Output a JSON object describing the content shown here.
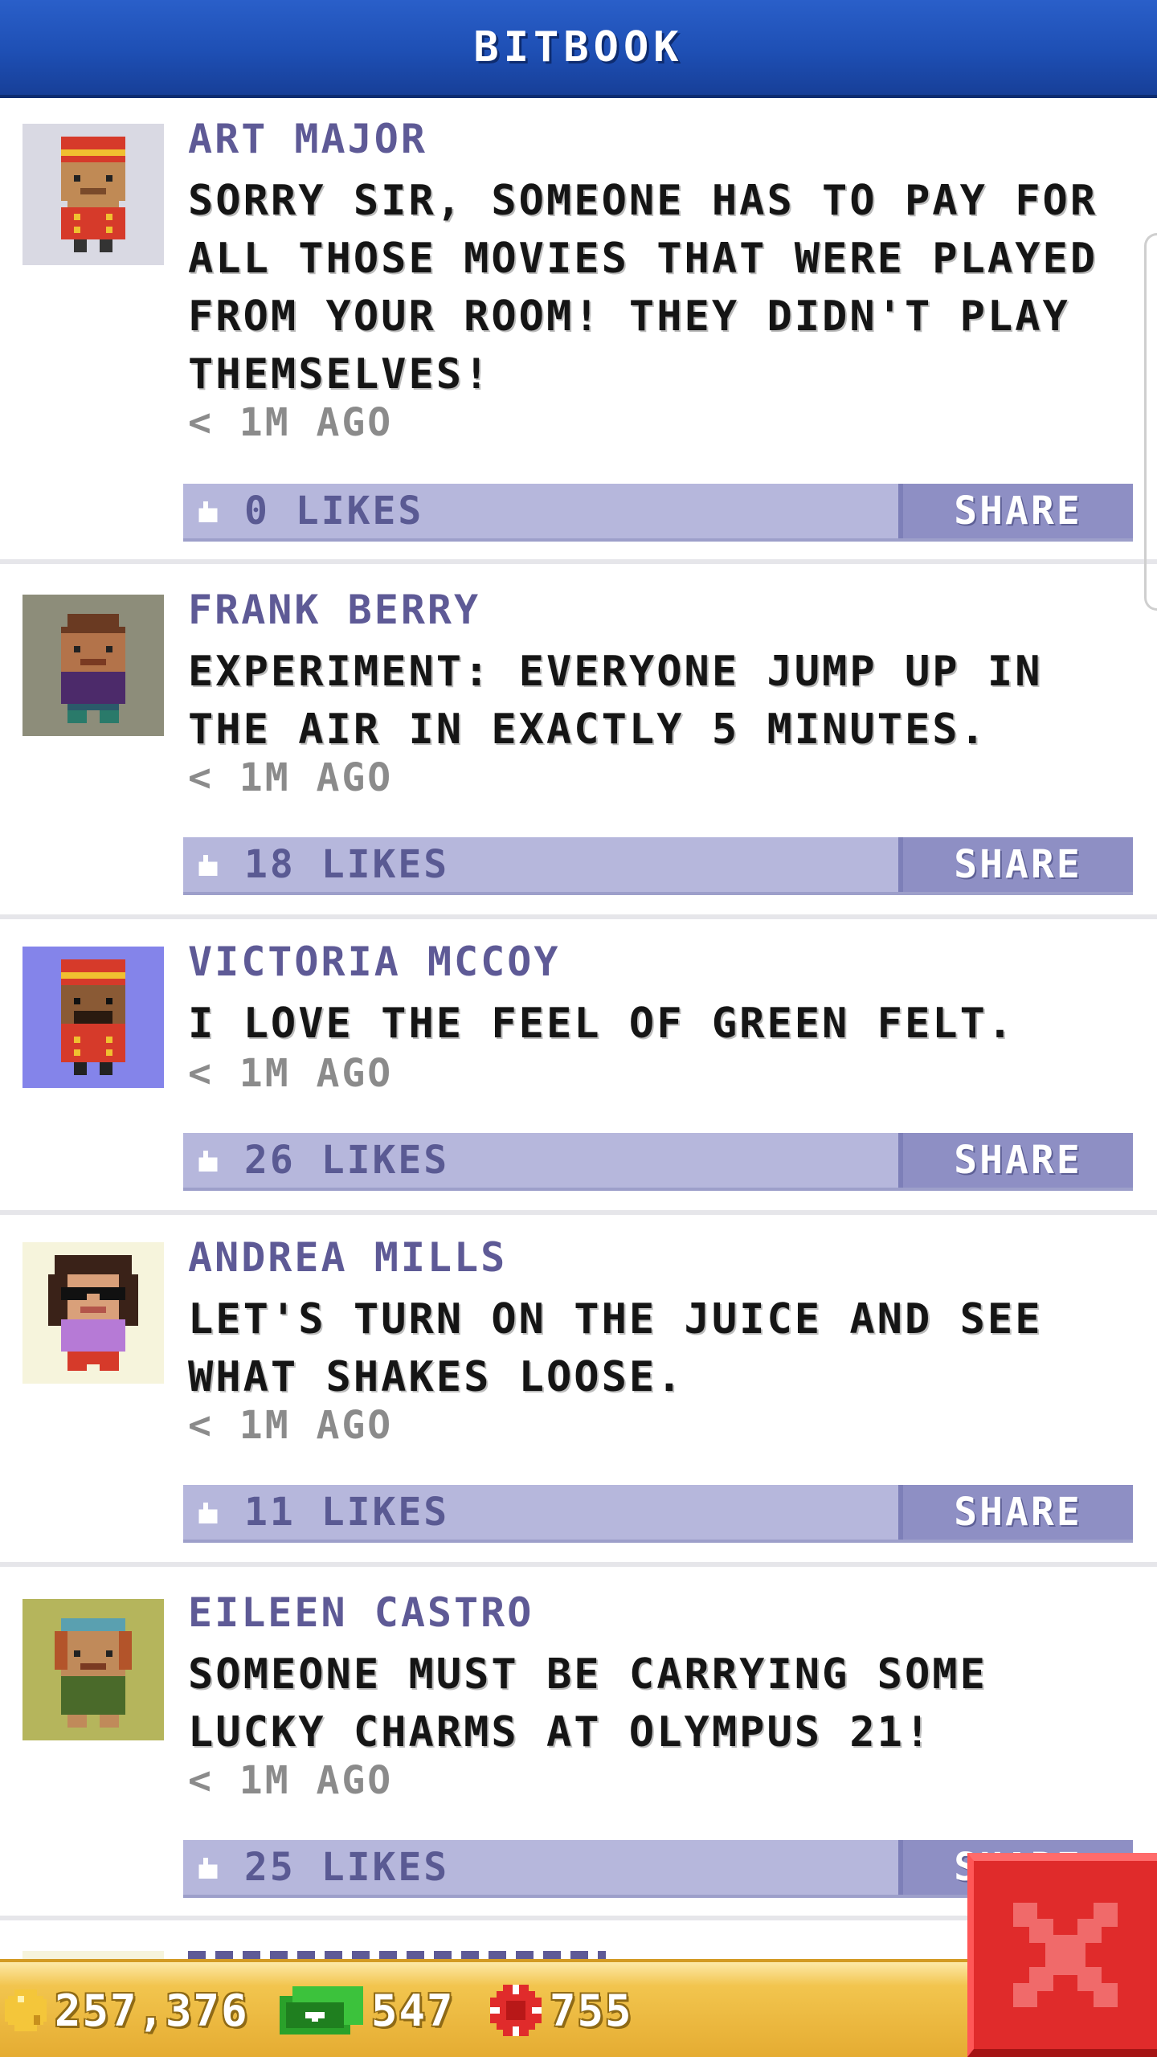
{
  "header": {
    "title": "BITBOOK"
  },
  "posts": [
    {
      "author": "ART MAJOR",
      "text": "SORRY SIR, SOMEONE HAS TO PAY FOR ALL THOSE MOVIES THAT WERE PLAYED FROM YOUR ROOM! THEY DIDN'T PLAY THEMSELVES!",
      "time": "< 1M AGO",
      "likes": "0 LIKES",
      "share": "SHARE",
      "avatar_bg": "#d9d9e3"
    },
    {
      "author": "FRANK BERRY",
      "text": "EXPERIMENT: EVERYONE JUMP UP IN THE AIR IN EXACTLY 5 MINUTES.",
      "time": "< 1M AGO",
      "likes": "18 LIKES",
      "share": "SHARE",
      "avatar_bg": "#8d8d7a"
    },
    {
      "author": "VICTORIA MCCOY",
      "text": "I LOVE THE FEEL OF GREEN FELT.",
      "time": "< 1M AGO",
      "likes": "26 LIKES",
      "share": "SHARE",
      "avatar_bg": "#8484ea"
    },
    {
      "author": "ANDREA MILLS",
      "text": "LET'S TURN ON THE JUICE AND SEE WHAT SHAKES LOOSE.",
      "time": "< 1M AGO",
      "likes": "11 LIKES",
      "share": "SHARE",
      "avatar_bg": "#f6f4dc"
    },
    {
      "author": "EILEEN CASTRO",
      "text": "SOMEONE MUST BE CARRYING SOME LUCKY CHARMS AT OLYMPUS 21!",
      "time": "< 1M AGO",
      "likes": "25 LIKES",
      "share": "SHARE",
      "avatar_bg": "#b5b55c"
    }
  ],
  "currency": {
    "coins": "257,376",
    "bux": "547",
    "chips": "755"
  },
  "colors": {
    "header": "#1e4fb4",
    "like_bar": "#b6b7dc",
    "share_button": "#8e8fc4",
    "bottom_bar": "#e5ac32",
    "close_button": "#e02b2b"
  }
}
